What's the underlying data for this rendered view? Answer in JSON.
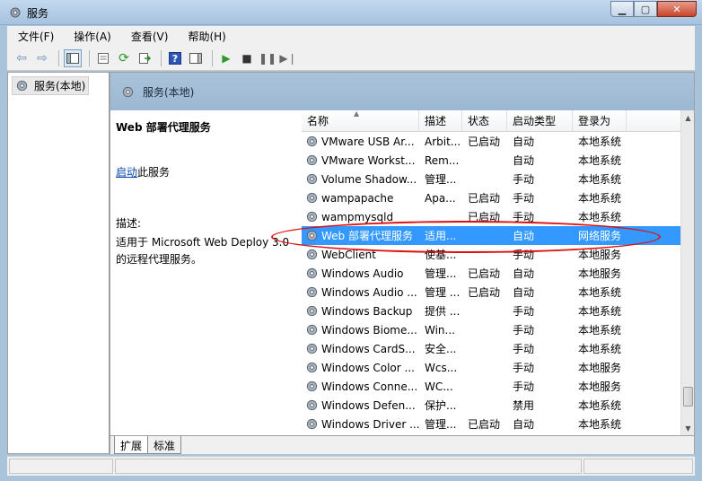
{
  "window": {
    "title": "服务"
  },
  "menu": [
    {
      "label": "文件(F)",
      "name": "menu-file"
    },
    {
      "label": "操作(A)",
      "name": "menu-action"
    },
    {
      "label": "查看(V)",
      "name": "menu-view"
    },
    {
      "label": "帮助(H)",
      "name": "menu-help"
    }
  ],
  "tree": {
    "root_label": "服务(本地)"
  },
  "content": {
    "header_title": "服务(本地)",
    "detail": {
      "service_title": "Web 部署代理服务",
      "start_link": "启动",
      "start_suffix": "此服务",
      "desc_label": "描述:",
      "desc_text": "适用于 Microsoft Web Deploy 3.0\n的远程代理服务。"
    }
  },
  "list": {
    "columns": [
      "名称",
      "描述",
      "状态",
      "启动类型",
      "登录为"
    ],
    "rows": [
      {
        "name": "VMware USB Ar...",
        "desc": "Arbit...",
        "status": "已启动",
        "startup": "自动",
        "logon": "本地系统"
      },
      {
        "name": "VMware Workst...",
        "desc": "Rem...",
        "status": "",
        "startup": "自动",
        "logon": "本地系统"
      },
      {
        "name": "Volume Shadow...",
        "desc": "管理...",
        "status": "",
        "startup": "手动",
        "logon": "本地系统"
      },
      {
        "name": "wampapache",
        "desc": "Apa...",
        "status": "已启动",
        "startup": "手动",
        "logon": "本地系统"
      },
      {
        "name": "wampmysqld",
        "desc": "",
        "status": "已启动",
        "startup": "手动",
        "logon": "本地系统"
      },
      {
        "name": "Web 部署代理服务",
        "desc": "适用...",
        "status": "",
        "startup": "自动",
        "logon": "网络服务",
        "selected": true
      },
      {
        "name": "WebClient",
        "desc": "使基...",
        "status": "",
        "startup": "手动",
        "logon": "本地服务"
      },
      {
        "name": "Windows Audio",
        "desc": "管理...",
        "status": "已启动",
        "startup": "自动",
        "logon": "本地服务"
      },
      {
        "name": "Windows Audio ...",
        "desc": "管理 ...",
        "status": "已启动",
        "startup": "自动",
        "logon": "本地系统"
      },
      {
        "name": "Windows Backup",
        "desc": "提供 ...",
        "status": "",
        "startup": "手动",
        "logon": "本地系统"
      },
      {
        "name": "Windows Biome...",
        "desc": "Win...",
        "status": "",
        "startup": "手动",
        "logon": "本地系统"
      },
      {
        "name": "Windows CardS...",
        "desc": "安全...",
        "status": "",
        "startup": "手动",
        "logon": "本地系统"
      },
      {
        "name": "Windows Color ...",
        "desc": "Wcs...",
        "status": "",
        "startup": "手动",
        "logon": "本地服务"
      },
      {
        "name": "Windows Conne...",
        "desc": "WC...",
        "status": "",
        "startup": "手动",
        "logon": "本地服务"
      },
      {
        "name": "Windows Defen...",
        "desc": "保护...",
        "status": "",
        "startup": "禁用",
        "logon": "本地系统"
      },
      {
        "name": "Windows Driver ...",
        "desc": "管理...",
        "status": "已启动",
        "startup": "自动",
        "logon": "本地系统"
      }
    ]
  },
  "tabs": [
    "扩展",
    "标准"
  ],
  "colors": {
    "selection": "#3399ff",
    "annotation": "#dd1111",
    "header": "#a9c3da"
  }
}
